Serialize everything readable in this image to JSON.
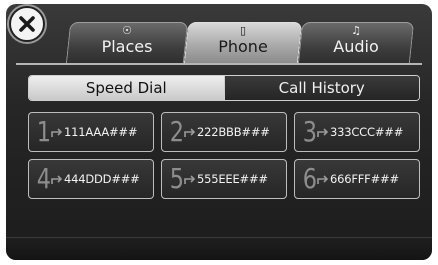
{
  "tabs": [
    {
      "label": "Places",
      "icon": "compass-icon",
      "glyph": "☉"
    },
    {
      "label": "Phone",
      "icon": "phone-icon",
      "glyph": "▯"
    },
    {
      "label": "Audio",
      "icon": "music-note-icon",
      "glyph": "♫"
    }
  ],
  "active_tab": "Phone",
  "segments": {
    "speed_dial": "Speed Dial",
    "call_history": "Call History"
  },
  "speed_dials": [
    {
      "number": "1",
      "entry": "111AAA###"
    },
    {
      "number": "2",
      "entry": "222BBB###"
    },
    {
      "number": "3",
      "entry": "333CCC###"
    },
    {
      "number": "4",
      "entry": "444DDD###"
    },
    {
      "number": "5",
      "entry": "555EEE###"
    },
    {
      "number": "6",
      "entry": "666FFF###"
    }
  ],
  "colors": {
    "active_tab": "#a9a9a9",
    "background": "#262626",
    "digit": "#8d8d8d"
  }
}
